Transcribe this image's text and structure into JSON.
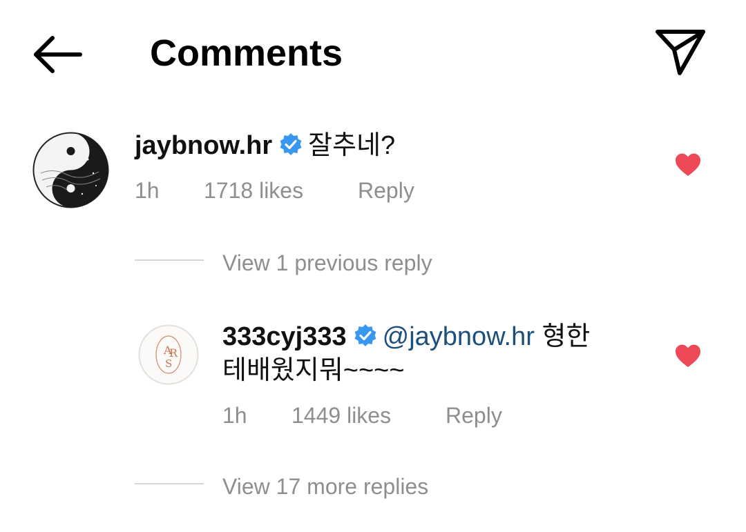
{
  "header": {
    "title": "Comments",
    "back_icon": "arrow-left-icon",
    "send_icon": "paper-plane-icon"
  },
  "comments": [
    {
      "username": "jaybnow.hr",
      "verified": true,
      "text": "잘추네?",
      "time": "1h",
      "likes": "1718 likes",
      "reply_label": "Reply",
      "liked": true
    }
  ],
  "previous_replies": "View 1 previous reply",
  "replies": [
    {
      "username": "333cyj333",
      "verified": true,
      "mention": "@jaybnow.hr",
      "text_line1": "형한",
      "text_line2": "테배웠지뭐~~~~",
      "time": "1h",
      "likes": "1449 likes",
      "reply_label": "Reply",
      "liked": true
    }
  ],
  "more_replies": "View 17 more replies",
  "colors": {
    "heart": "#ed4956",
    "verified": "#3897f0",
    "mention": "#1c4f7c",
    "meta": "#8e8e8e"
  }
}
